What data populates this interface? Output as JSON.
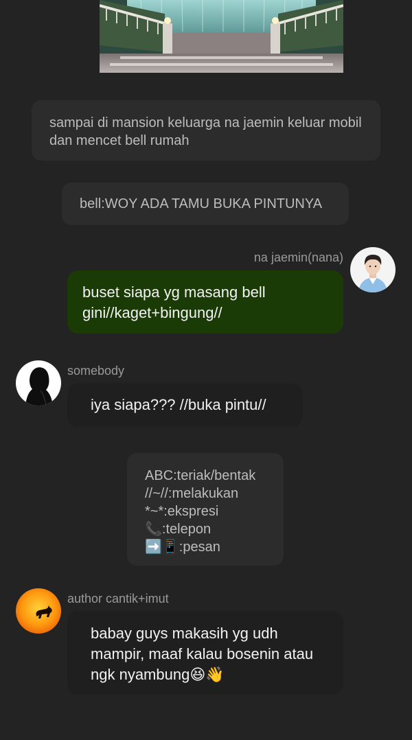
{
  "narration": {
    "arrival": "sampai di mansion keluarga na jaemin keluar mobil dan mencet bell rumah",
    "bell": "bell:WOY ADA TAMU BUKA PINTUNYA",
    "legend": [
      "ABC:teriak/bentak",
      "//~//:melakukan",
      "*~*:ekspresi",
      "📞:telepon",
      "➡️📱:pesan"
    ]
  },
  "messages": [
    {
      "sender": "na jaemin(nana)",
      "text": "buset siapa yg masang bell gini//kaget+bingung//",
      "side": "right",
      "bubble_color": "#1b3b06"
    },
    {
      "sender": "somebody",
      "text": "iya siapa??? //buka pintu//",
      "side": "left",
      "bubble_color": "#1f1f1f"
    },
    {
      "sender": "author cantik+imut",
      "text": "babay guys makasih yg udh mampir, maaf kalau bosenin atau ngk nyambung😆👋",
      "side": "left",
      "bubble_color": "#1f1f1f"
    }
  ],
  "colors": {
    "background": "#232323",
    "narration_bg": "#2c2c2c",
    "name_text": "#9a9a9a"
  }
}
